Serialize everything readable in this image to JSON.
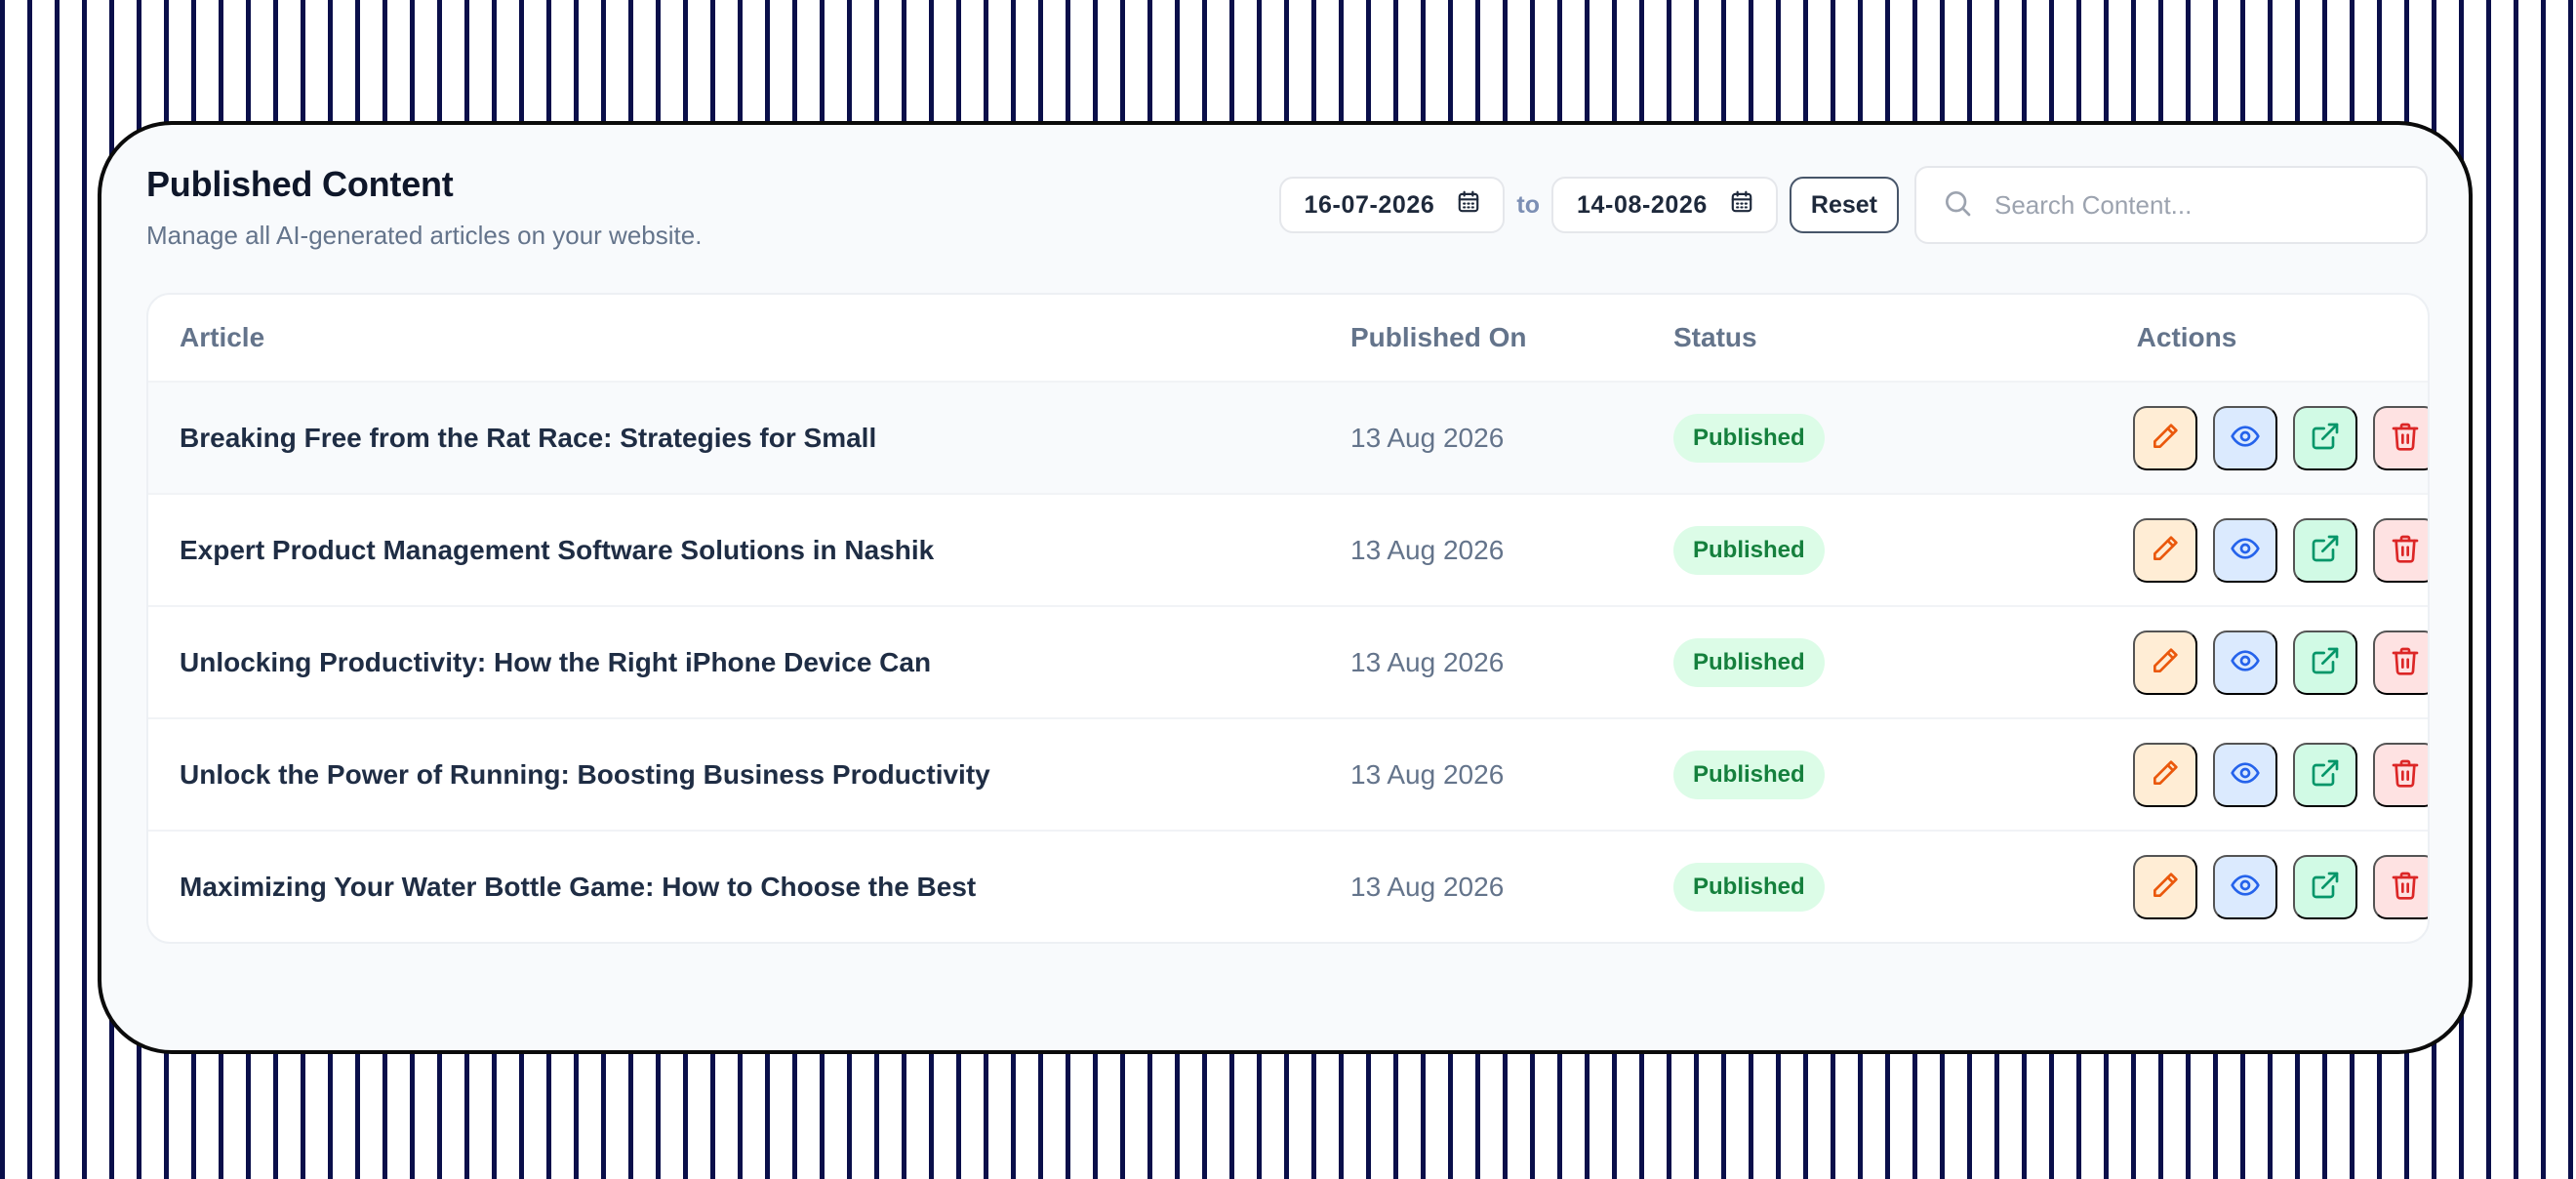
{
  "header": {
    "title": "Published Content",
    "subtitle": "Manage all AI-generated articles on your website."
  },
  "filters": {
    "date_from": "16-07-2026",
    "to_label": "to",
    "date_to": "14-08-2026",
    "reset_label": "Reset",
    "search_placeholder": "Search Content...",
    "search_value": ""
  },
  "table": {
    "columns": [
      "Article",
      "Published On",
      "Status",
      "Actions"
    ],
    "rows": [
      {
        "article": "Breaking Free from the Rat Race: Strategies for Small",
        "published_on": "13 Aug 2026",
        "status": "Published"
      },
      {
        "article": "Expert Product Management Software Solutions in Nashik",
        "published_on": "13 Aug 2026",
        "status": "Published"
      },
      {
        "article": "Unlocking Productivity: How the Right iPhone Device Can",
        "published_on": "13 Aug 2026",
        "status": "Published"
      },
      {
        "article": "Unlock the Power of Running: Boosting Business Productivity",
        "published_on": "13 Aug 2026",
        "status": "Published"
      },
      {
        "article": "Maximizing Your Water Bottle Game: How to Choose the Best",
        "published_on": "13 Aug 2026",
        "status": "Published"
      }
    ],
    "actions": [
      {
        "name": "edit",
        "icon": "pencil-icon",
        "bg": "#ffedd5",
        "color": "#ea580c"
      },
      {
        "name": "view",
        "icon": "eye-icon",
        "bg": "#dbeafe",
        "color": "#2563eb"
      },
      {
        "name": "open",
        "icon": "external-link-icon",
        "bg": "#d1fae5",
        "color": "#059669"
      },
      {
        "name": "delete",
        "icon": "trash-icon",
        "bg": "#fee2e2",
        "color": "#dc2626"
      }
    ]
  },
  "colors": {
    "status_published_bg": "#dcfce7",
    "status_published_text": "#15803d",
    "frame": "#0a0f4a"
  }
}
